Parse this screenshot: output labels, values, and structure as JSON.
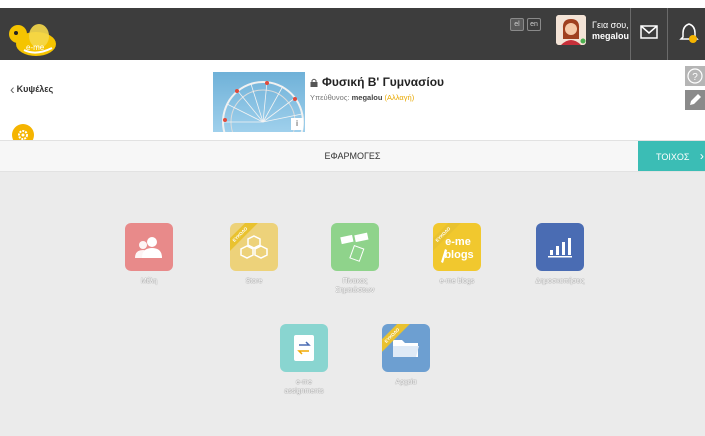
{
  "topbar": {
    "lang_el": "el",
    "lang_en": "en",
    "greeting": "Γεια σου,",
    "username": "megalou"
  },
  "course": {
    "back_label": "Κυψέλες",
    "title": "Φυσική Β' Γυμνασίου",
    "responsible_label": "Υπεύθυνος:",
    "responsible_name": "megalou",
    "change_label": "(Αλλαγή)",
    "info_label": "i"
  },
  "tabs": {
    "apps_label": "ΕΦΑΡΜΟΓΕΣ",
    "wall_label": "ΤΟΙΧΟΣ"
  },
  "apps": [
    {
      "label": "Μέλη",
      "color": "#e88a8a",
      "icon": "members-icon",
      "ribbon": ""
    },
    {
      "label": "Store",
      "color": "#edd27a",
      "icon": "hive-icon",
      "ribbon": "ΕΥΚΟΛΟ"
    },
    {
      "label": "Πίνακας Σημειώσεων",
      "color": "#8fd38b",
      "icon": "sticky-notes-icon",
      "ribbon": ""
    },
    {
      "label": "e-me blogs",
      "color": "#f1c82e",
      "icon": "blog-icon",
      "ribbon": "ΕΥΚΟΛΟ"
    },
    {
      "label": "Δημοσκοπήσεις",
      "color": "#4a6cb3",
      "icon": "poll-chart-icon",
      "ribbon": ""
    },
    {
      "label": "e-me assignments",
      "color": "#89d5d0",
      "icon": "assignments-icon",
      "ribbon": ""
    },
    {
      "label": "Αρχεία",
      "color": "#6d9fd1",
      "icon": "folder-icon",
      "ribbon": "ΕΥΚΟΛΟ"
    }
  ]
}
